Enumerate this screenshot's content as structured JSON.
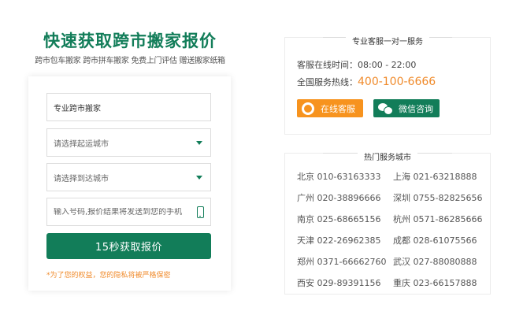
{
  "promo": {
    "headline": "快速获取跨市搬家报价",
    "subline": "跨市包车搬家 跨市拼车搬家 免费上门评估 赠送搬家纸箱"
  },
  "form": {
    "service_value": "专业跨市搬家",
    "origin_placeholder": "请选择起运城市",
    "destination_placeholder": "请选择到达城市",
    "phone_placeholder": "输入号码,报价结果将发送到您的手机",
    "submit_label": "15秒获取报价",
    "privacy_note": "*为了您的权益，您的隐私将被严格保密"
  },
  "service_panel": {
    "title": "专业客服一对一服务",
    "hours_label": "客服在线时间：08:00 - 22:00",
    "hotline_label": "全国服务热线：",
    "hotline_number": "400-100-6666",
    "online_button": "在线客服",
    "wechat_button": "微信咨询",
    "accent_orange": "#f7931e",
    "accent_green": "#127d59"
  },
  "cities_panel": {
    "title": "热门服务城市",
    "cities": [
      "北京 010-63163333",
      "上海 021-63218888",
      "广州 020-38896666",
      "深圳 0755-82825656",
      "南京 025-68665156",
      "杭州 0571-86285666",
      "天津 022-26962385",
      "成都 028-61075566",
      "郑州 0371-66662760",
      "武汉 027-88080888",
      "西安 029-89391156",
      "重庆 023-66157888"
    ]
  }
}
